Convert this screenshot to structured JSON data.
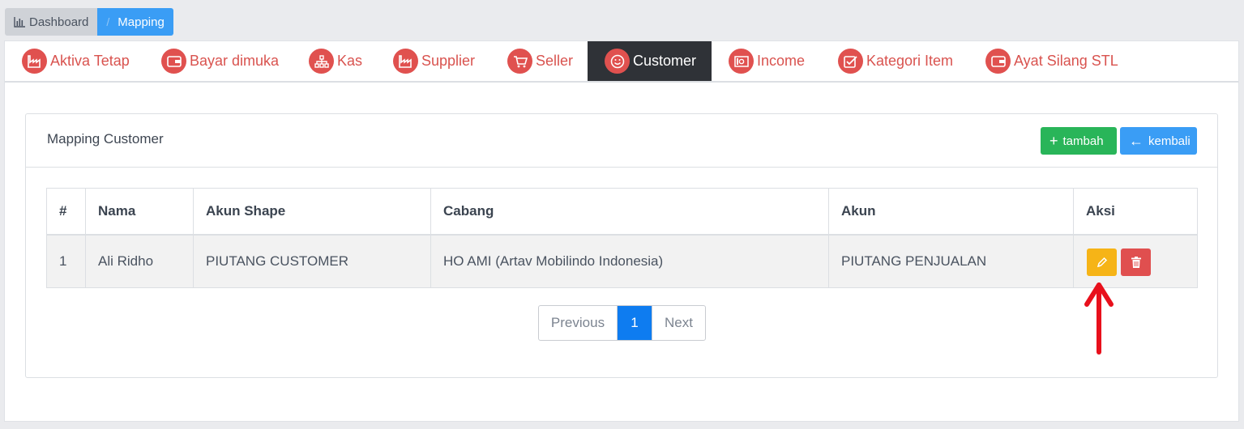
{
  "breadcrumb": {
    "dashboard": "Dashboard",
    "separator": "/",
    "current": "Mapping"
  },
  "tabs": [
    {
      "label": "Aktiva Tetap",
      "icon": "factory-icon"
    },
    {
      "label": "Bayar dimuka",
      "icon": "wallet-icon"
    },
    {
      "label": "Kas",
      "icon": "sitemap-icon"
    },
    {
      "label": "Supplier",
      "icon": "factory-icon"
    },
    {
      "label": "Seller",
      "icon": "cart-icon"
    },
    {
      "label": "Customer",
      "icon": "smile-icon",
      "active": true
    },
    {
      "label": "Income",
      "icon": "money-icon"
    },
    {
      "label": "Kategori Item",
      "icon": "checkbox-icon"
    },
    {
      "label": "Ayat Silang STL",
      "icon": "wallet-icon"
    }
  ],
  "panel": {
    "title": "Mapping Customer",
    "add_label": "tambah",
    "back_label": "kembali"
  },
  "table": {
    "headers": [
      "#",
      "Nama",
      "Akun Shape",
      "Cabang",
      "Akun",
      "Aksi"
    ],
    "rows": [
      [
        "1",
        "Ali Ridho",
        "PIUTANG CUSTOMER",
        "HO AMI (Artav Mobilindo Indonesia)",
        "PIUTANG PENJUALAN"
      ]
    ]
  },
  "pagination": {
    "prev": "Previous",
    "current": "1",
    "next": "Next"
  },
  "colors": {
    "accent_red": "#e0514f",
    "primary": "#3a9df5",
    "success": "#29b559",
    "warning": "#f6b417",
    "danger": "#e04f4f",
    "annotation_arrow": "#e8101c"
  }
}
